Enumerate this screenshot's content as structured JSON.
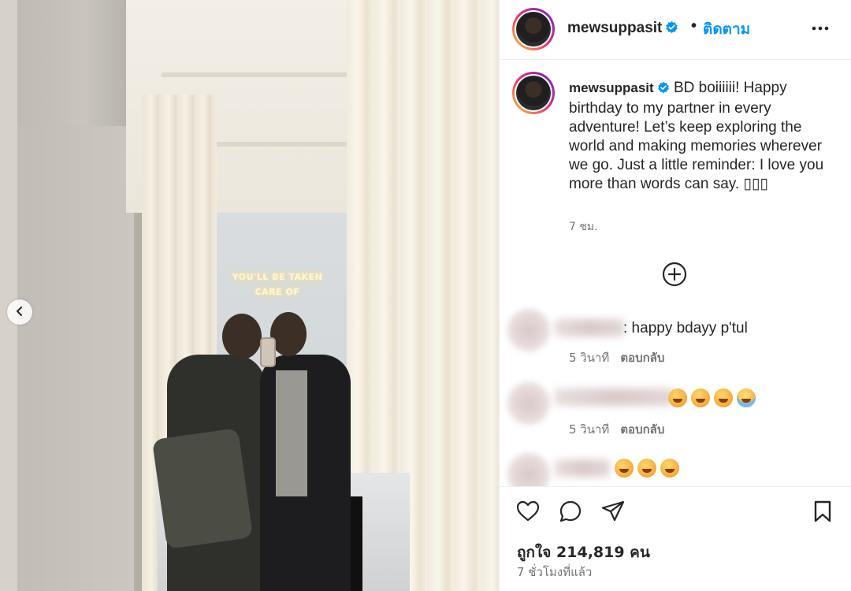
{
  "photo": {
    "neon_sign_line1": "YOU'LL BE TAKEN",
    "neon_sign_line2": "CARE OF"
  },
  "header": {
    "username": "mewsuppasit",
    "separator": "•",
    "follow_label": "ติดตาม"
  },
  "caption": {
    "username": "mewsuppasit",
    "text": "BD boiiiiii! Happy birthday to my partner in every adventure! Let’s keep exploring the world and making memories wherever we go. Just a little reminder: I love you more than words can say. ▯▯▯",
    "time": "7 ชม."
  },
  "comments": [
    {
      "text": ": happy bdayy p'tul",
      "time": "5 วินาที",
      "reply_label": "ตอบกลับ",
      "emoji_count": 0
    },
    {
      "text": "",
      "time": "5 วินาที",
      "reply_label": "ตอบกลับ",
      "emoji_count": 4
    },
    {
      "text": "",
      "emoji_count": 3
    }
  ],
  "likes": {
    "label": "ถูกใจ 214,819 คน"
  },
  "post_time": "7 ชั่วโมงที่แล้ว",
  "colors": {
    "follow_blue": "#0095f6",
    "verified_blue": "#0095f6",
    "secondary_text": "#737373"
  }
}
